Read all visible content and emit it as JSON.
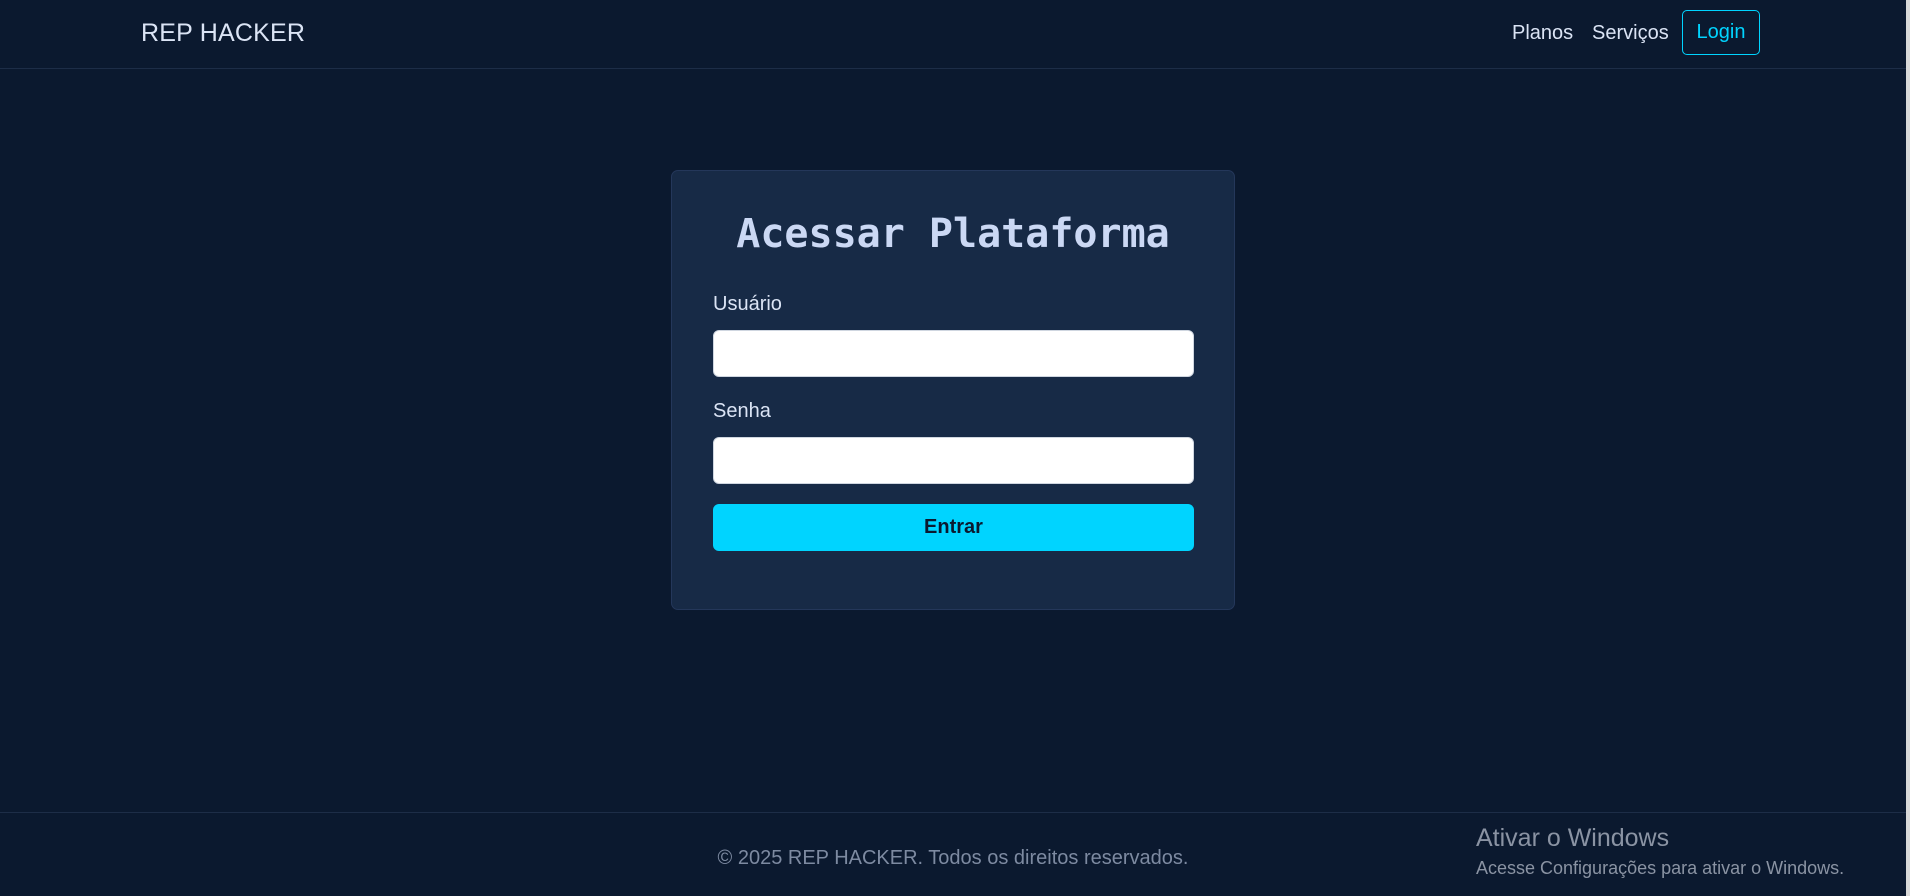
{
  "navbar": {
    "brand": "REP HACKER",
    "links": [
      "Planos",
      "Serviços"
    ],
    "login_label": "Login"
  },
  "login_card": {
    "title": "Acessar Plataforma",
    "user_label": "Usuário",
    "user_value": "",
    "password_label": "Senha",
    "password_value": "",
    "submit_label": "Entrar"
  },
  "footer": {
    "text": "© 2025 REP HACKER. Todos os direitos reservados."
  },
  "windows_watermark": {
    "title": "Ativar o Windows",
    "subtitle": "Acesse Configurações para ativar o Windows."
  },
  "colors": {
    "background": "#0b192f",
    "card": "#172a46",
    "accent": "#00d4ff",
    "text": "#dbe4f5"
  }
}
